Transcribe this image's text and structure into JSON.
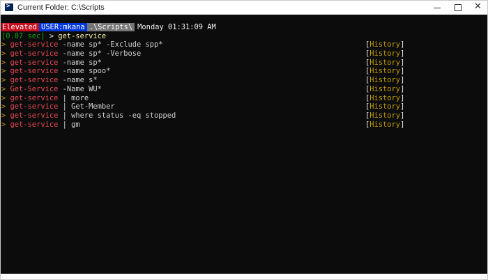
{
  "window": {
    "title": "Current Folder: C:\\Scripts",
    "icon": "powershell-icon",
    "controls": {
      "minimize_icon": "minimize-icon",
      "maximize_icon": "maximize-icon",
      "close_glyph": "✕"
    }
  },
  "prompt": {
    "elevated": "Elevated",
    "user": "USER:mkana",
    "folder": ".\\Scripts\\",
    "datetime": "Monday 01:31:09 AM",
    "elapsed": "[0.07 sec]",
    "arrow": ">",
    "command": "get-service"
  },
  "history": {
    "marker": ">",
    "open_bracket": "[",
    "label": "History",
    "close_bracket": "]",
    "items": [
      {
        "cmd": "get-service",
        "args": " -name sp* -Exclude spp*"
      },
      {
        "cmd": "get-service",
        "args": " -name sp* -Verbose"
      },
      {
        "cmd": "get-service",
        "args": " -name sp*"
      },
      {
        "cmd": "get-service",
        "args": " -name spoo*"
      },
      {
        "cmd": "get-service",
        "args": " -name s*"
      },
      {
        "cmd": "Get-Service",
        "args": " -Name WU*"
      },
      {
        "cmd": "get-service",
        "args": " | more"
      },
      {
        "cmd": "get-service",
        "args": " | Get-Member"
      },
      {
        "cmd": "get-service",
        "args": " | where status -eq stopped"
      },
      {
        "cmd": "get-service",
        "args": " | gm"
      }
    ]
  },
  "colors": {
    "console_background": "#0c0c0c",
    "elevated_bg": "#c50f1f",
    "user_bg": "#0037da",
    "folder_bg": "#767676",
    "command_red": "#e74856",
    "marker_gold": "#c19c00",
    "history_yellow": "#f9f1a5"
  }
}
